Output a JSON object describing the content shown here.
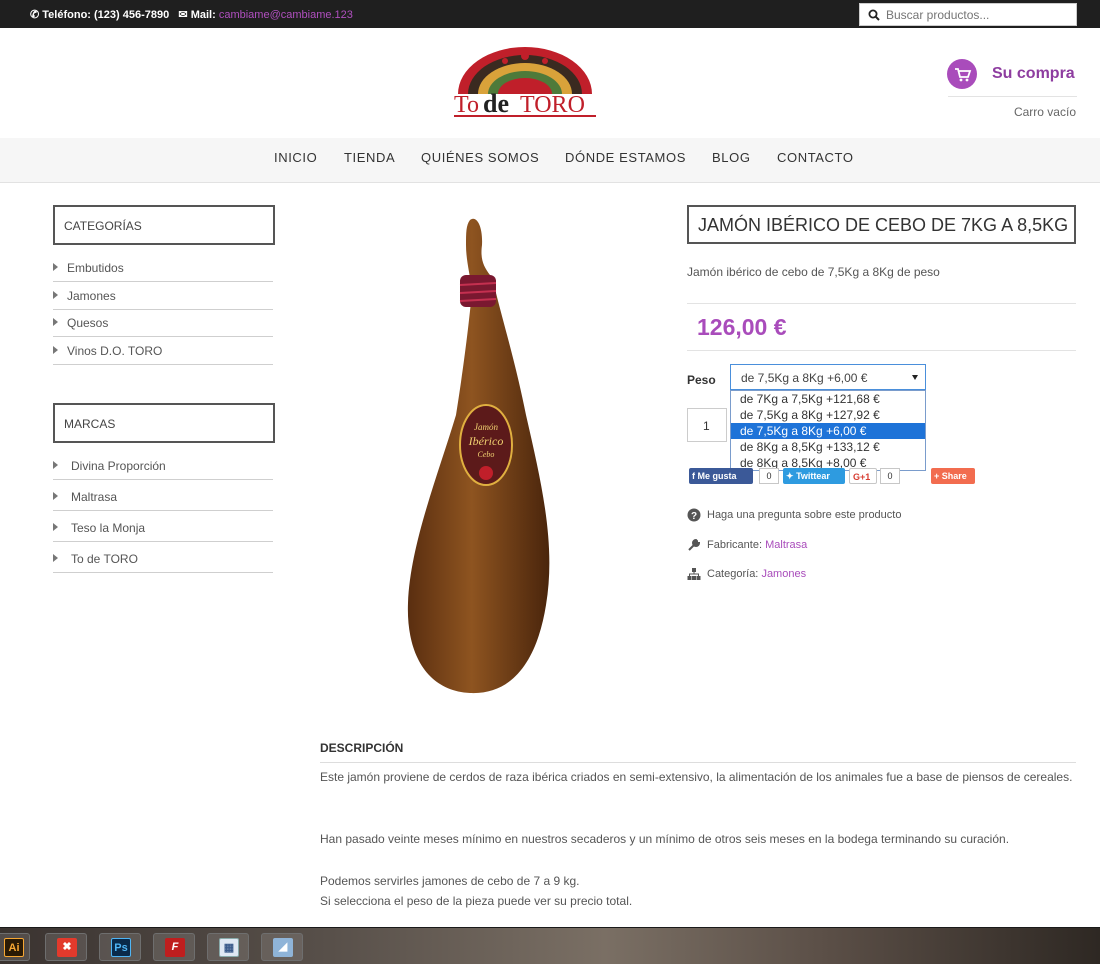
{
  "topbar": {
    "phone": "Teléfono: (123) 456-7890",
    "mail_label": "Mail:",
    "mail": "cambiame@cambiame.123",
    "search_placeholder": "Buscar productos..."
  },
  "cart": {
    "title": "Su compra",
    "status": "Carro vacío"
  },
  "nav": [
    "INICIO",
    "TIENDA",
    "QUIÉNES SOMOS",
    "DÓNDE ESTAMOS",
    "BLOG",
    "CONTACTO"
  ],
  "sidebar": {
    "categories_title": "CATEGORÍAS",
    "categories": [
      "Embutidos",
      "Jamones",
      "Quesos",
      "Vinos D.O. TORO"
    ],
    "brands_title": "MARCAS",
    "brands": [
      "Divina Proporción",
      "Maltrasa",
      "Teso la Monja",
      "To de TORO"
    ]
  },
  "product": {
    "title": "JAMÓN IBÉRICO DE CEBO DE 7KG A 8,5KG",
    "short_description": "Jamón ibérico de cebo de 7,5Kg a 8Kg de peso",
    "price": "126,00 €",
    "peso_label": "Peso",
    "selected_option": "de 7,5Kg a 8Kg +6,00 €",
    "options": [
      "de 7Kg a 7,5Kg +121,68 €",
      "de 7,5Kg a 8Kg +127,92 €",
      "de 7,5Kg a 8Kg +6,00 €",
      "de 8Kg a 8,5Kg +133,12 €",
      "de 8Kg a 8,5Kg +8,00 €"
    ],
    "quantity": "1",
    "question_text": "Haga una pregunta sobre este producto",
    "manufacturer_label": "Fabricante:",
    "manufacturer": "Maltrasa",
    "category_label": "Categoría:",
    "category": "Jamones"
  },
  "social": {
    "facebook": "Me gusta",
    "facebook_count": "0",
    "twitter": "Twittear",
    "google": "G+1",
    "google_count": "0",
    "share": "Share"
  },
  "logo": {
    "text_to": "To",
    "text_de": "de",
    "text_toro": "TORO"
  },
  "description": {
    "heading": "DESCRIPCIÓN",
    "p1": "Este jamón proviene de cerdos de raza ibérica criados en semi-extensivo, la alimentación de los animales fue a base de piensos de cereales.",
    "p2": "Han pasado veinte meses mínimo en nuestros secaderos y un mínimo de otros seis meses en la bodega terminando su curación.",
    "p3a": "Podemos servirles jamones de cebo de 7 a 9 kg.",
    "p3b": "Si selecciona el peso de la pieza puede ver su precio total."
  },
  "taskbar": {
    "apps": [
      "Ai",
      "Ps"
    ]
  },
  "colors": {
    "accent": "#a94cbb",
    "topbar": "#1f1f1f",
    "select_highlight": "#1e73d8",
    "facebook": "#3b5998",
    "twitter": "#2e9be0",
    "share": "#f26c4f"
  }
}
